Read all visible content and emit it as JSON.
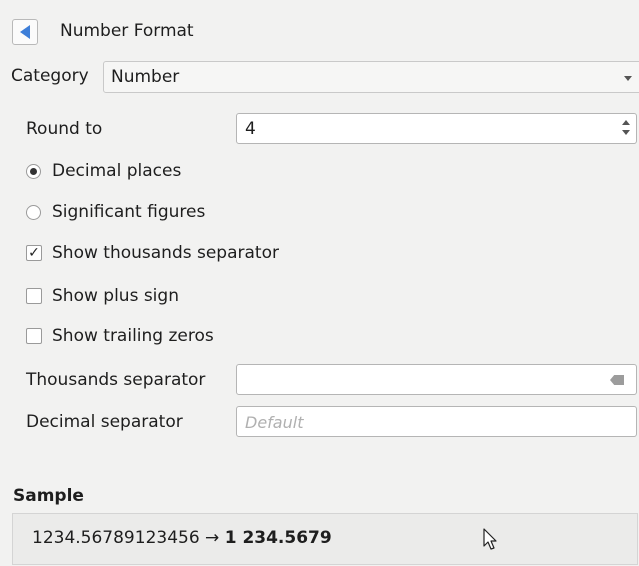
{
  "header": {
    "title": "Number Format"
  },
  "category": {
    "label": "Category",
    "value": "Number"
  },
  "round_to": {
    "label": "Round to",
    "value": "4"
  },
  "precision_mode": {
    "options": [
      {
        "label": "Decimal places",
        "checked": true
      },
      {
        "label": "Significant figures",
        "checked": false
      }
    ]
  },
  "options": {
    "show_thousands": {
      "label": "Show thousands separator",
      "checked": true,
      "mark": "✓"
    },
    "show_plus": {
      "label": "Show plus sign",
      "checked": false
    },
    "show_trailing": {
      "label": "Show trailing zeros",
      "checked": false
    }
  },
  "separators": {
    "thousands_label": "Thousands separator",
    "thousands_value": "",
    "decimal_label": "Decimal separator",
    "decimal_placeholder": "Default"
  },
  "sample": {
    "heading": "Sample",
    "input": "1234.56789123456 →",
    "output": "1 234.5679"
  },
  "colors": {
    "accent": "#3d7ed8",
    "background": "#f2f2f1"
  }
}
